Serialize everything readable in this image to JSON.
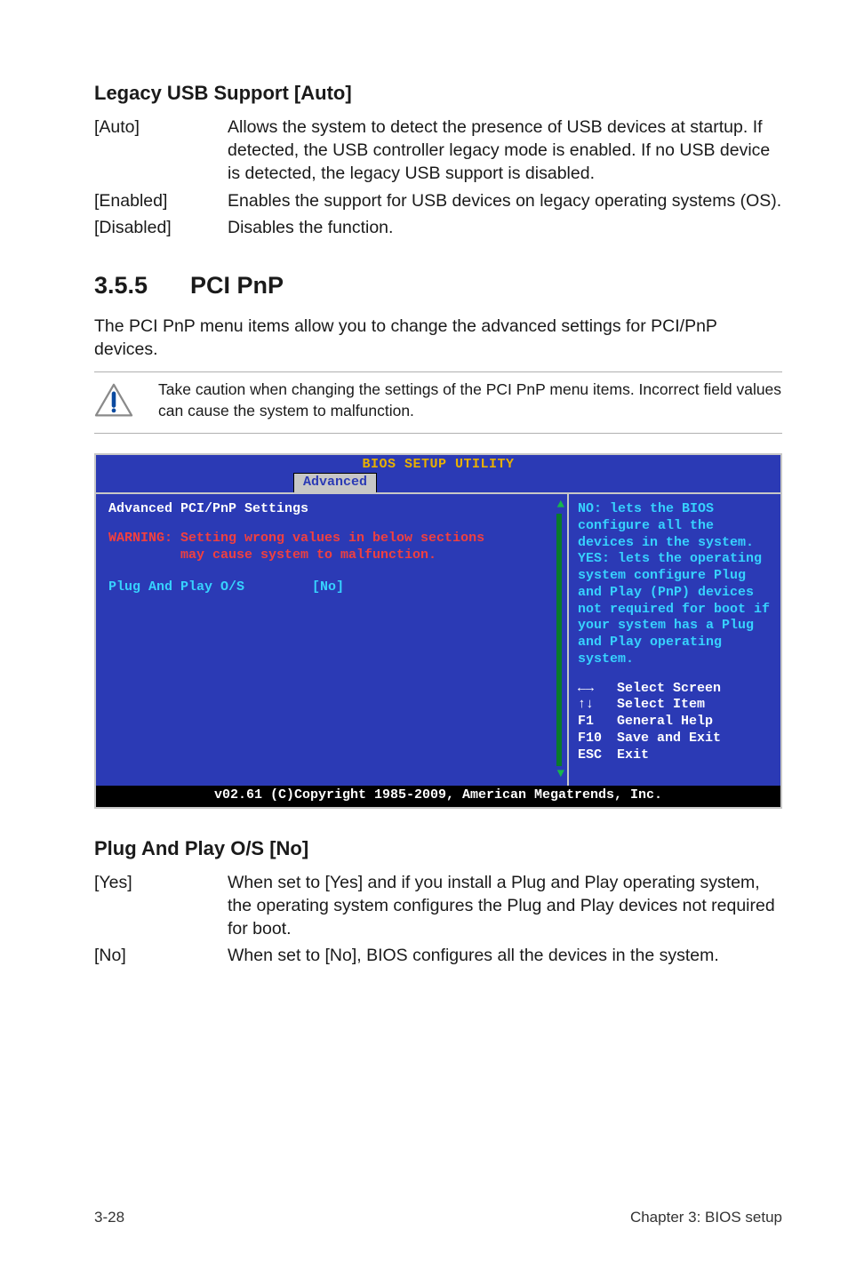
{
  "legacy": {
    "heading": "Legacy USB Support [Auto]",
    "rows": [
      {
        "term": "[Auto]",
        "desc": "Allows the system to detect the presence of USB devices at startup. If detected, the USB controller legacy mode is enabled. If no USB device is detected, the legacy USB support is disabled."
      },
      {
        "term": "[Enabled]",
        "desc": "Enables the support for USB devices on legacy operating systems (OS)."
      },
      {
        "term": "[Disabled]",
        "desc": "Disables the function."
      }
    ]
  },
  "section": {
    "num": "3.5.5",
    "title": "PCI PnP",
    "intro": "The PCI PnP menu items allow you to change the advanced settings for PCI/PnP devices.",
    "note": "Take caution when changing the settings of the PCI PnP menu items. Incorrect field values can cause the system to malfunction."
  },
  "bios": {
    "title": "BIOS SETUP UTILITY",
    "tab": "Advanced",
    "left": {
      "heading": "Advanced PCI/PnP Settings",
      "warn1": "WARNING: Setting wrong values in below sections",
      "warn2": "         may cause system to malfunction.",
      "setting_label": "Plug And Play O/S",
      "setting_value": "[No]"
    },
    "help": "NO: lets the BIOS configure all the devices in the system.\nYES: lets the operating system configure Plug and Play (PnP) devices not required for boot if your system has a Plug and Play operating system.",
    "nav": [
      {
        "key": "←→",
        "label": "Select Screen"
      },
      {
        "key": "↑↓",
        "label": "Select Item"
      },
      {
        "key": "F1",
        "label": "General Help"
      },
      {
        "key": "F10",
        "label": "Save and Exit"
      },
      {
        "key": "ESC",
        "label": "Exit"
      }
    ],
    "copyright": "v02.61 (C)Copyright 1985-2009, American Megatrends, Inc."
  },
  "plug": {
    "heading": "Plug And Play O/S [No]",
    "rows": [
      {
        "term": "[Yes]",
        "desc": "When set to [Yes] and if you install a Plug and Play operating system, the operating system configures the Plug and Play devices not required for boot."
      },
      {
        "term": "[No]",
        "desc": "When set to [No], BIOS configures all the devices in the system."
      }
    ]
  },
  "footer": {
    "left": "3-28",
    "right": "Chapter 3: BIOS setup"
  }
}
